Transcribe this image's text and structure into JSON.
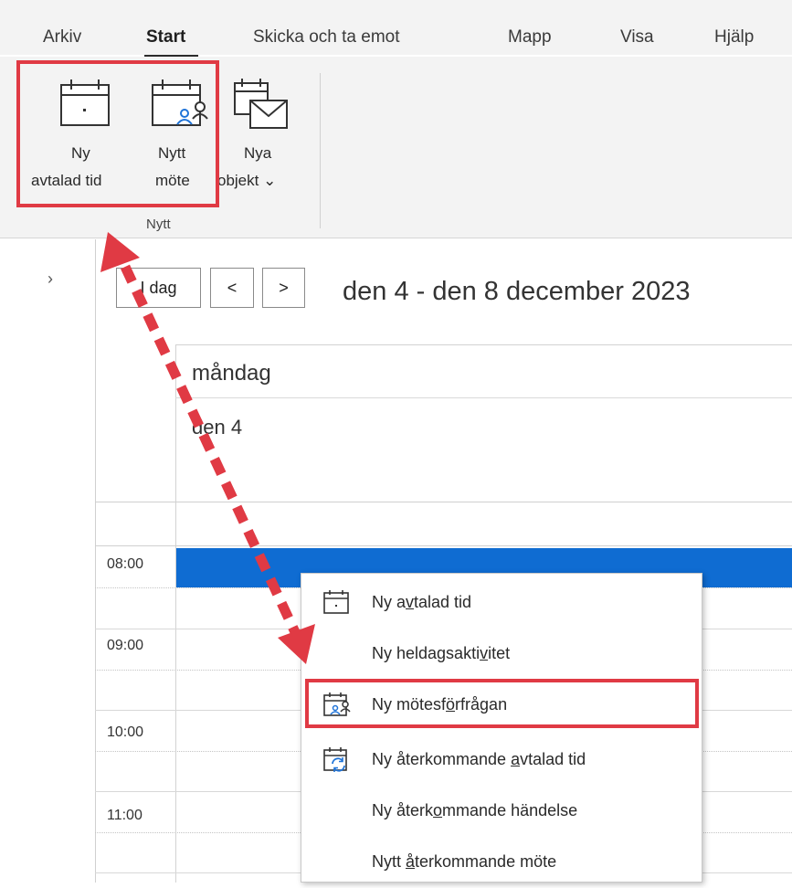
{
  "ribbon": {
    "tabs": [
      "Arkiv",
      "Start",
      "Skicka och ta emot",
      "Mapp",
      "Visa",
      "Hjälp"
    ],
    "active_tab": "Start",
    "buttons": {
      "new_appointment": {
        "line1": "Ny",
        "line2": "avtalad tid"
      },
      "new_meeting": {
        "line1": "Nytt",
        "line2": "möte"
      },
      "new_items": {
        "line1": "Nya",
        "line2": "objekt",
        "chevron": "⌄"
      }
    },
    "group_label": "Nytt"
  },
  "calendar": {
    "nav_collapse": "›",
    "today_button": "I dag",
    "prev_button": "<",
    "next_button": ">",
    "date_range": "den 4 - den 8 december 2023",
    "day_name": "måndag",
    "day_date": "den 4",
    "times": [
      "08:00",
      "09:00",
      "10:00",
      "11:00"
    ],
    "selection_color": "#0f6cd2"
  },
  "context_menu": {
    "items": [
      {
        "pre": "Ny a",
        "u": "v",
        "post": "talad tid",
        "icon": "calendar-icon"
      },
      {
        "pre": "Ny heldagsakti",
        "u": "v",
        "post": "itet",
        "icon": ""
      },
      {
        "pre": "Ny mötesf",
        "u": "ö",
        "post": "rfrågan",
        "icon": "meeting-request-icon"
      },
      {
        "pre": "Ny återkommande ",
        "u": "a",
        "post": "vtalad tid",
        "icon": "recurring-calendar-icon"
      },
      {
        "pre": "Ny återk",
        "u": "o",
        "post": "mmande händelse",
        "icon": ""
      },
      {
        "pre": "Nytt ",
        "u": "å",
        "post": "terkommande möte",
        "icon": ""
      }
    ]
  },
  "annotation": {
    "highlight_color": "#e03a44"
  }
}
